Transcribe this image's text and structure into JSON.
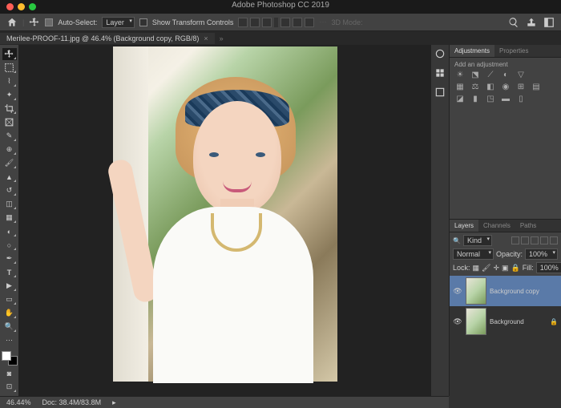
{
  "app_title": "Adobe Photoshop CC 2019",
  "options_bar": {
    "auto_select_label": "Auto-Select:",
    "auto_select_mode": "Layer",
    "show_transform_label": "Show Transform Controls",
    "mode_3d": "3D Mode:"
  },
  "document": {
    "tab_title": "Merilee-PROOF-11.jpg @ 46.4% (Background copy, RGB/8)"
  },
  "panels": {
    "adjustments": {
      "tab": "Adjustments",
      "properties_tab": "Properties",
      "add_label": "Add an adjustment"
    },
    "layers": {
      "tab_layers": "Layers",
      "tab_channels": "Channels",
      "tab_paths": "Paths",
      "kind_label": "Kind",
      "blend_mode": "Normal",
      "opacity_label": "Opacity:",
      "opacity_value": "100%",
      "lock_label": "Lock:",
      "fill_label": "Fill:",
      "fill_value": "100%",
      "items": [
        {
          "name": "Background copy",
          "visible": true,
          "locked": false
        },
        {
          "name": "Background",
          "visible": true,
          "locked": true
        }
      ]
    }
  },
  "status": {
    "zoom": "46.44%",
    "doc_info": "Doc: 38.4M/83.8M"
  }
}
